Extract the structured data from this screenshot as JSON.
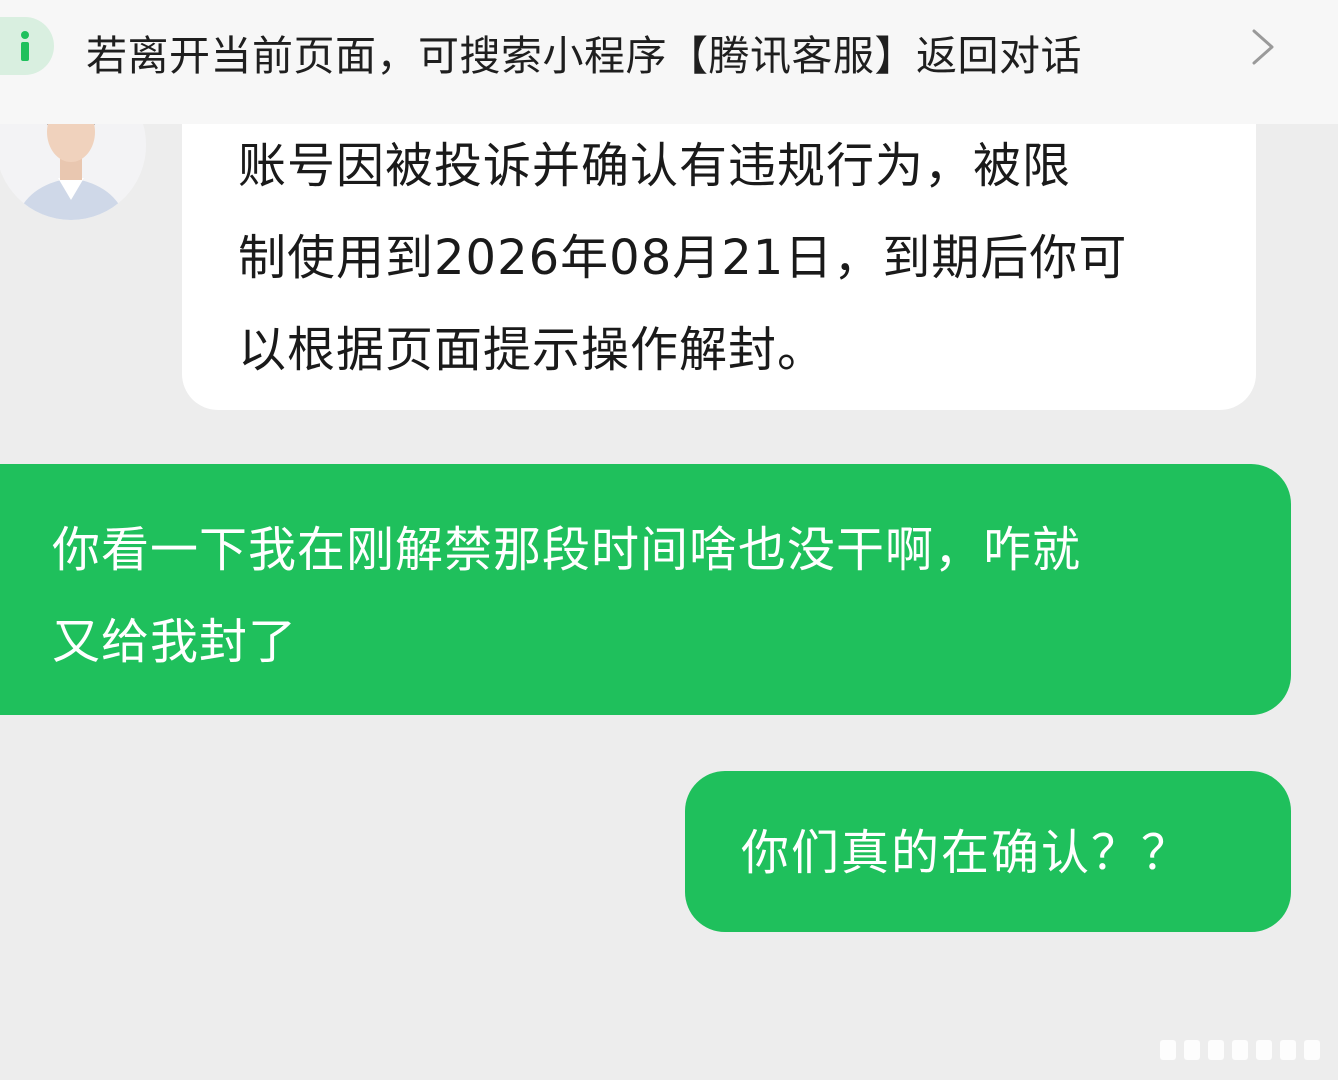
{
  "notice": {
    "text": "若离开当前页面，可搜索小程序【腾讯客服】返回对话",
    "icon": "info-icon",
    "accent_color": "#1fc05c"
  },
  "messages": [
    {
      "sender": "agent",
      "lines": [
        "账号因被投诉并确认有违规行为，被限",
        "制使用到2026年08月21日，到期后你可",
        "以根据页面提示操作解封。"
      ]
    },
    {
      "sender": "user",
      "lines": [
        "你看一下我在刚解禁那段时间啥也没干啊，咋就",
        "又给我封了"
      ]
    },
    {
      "sender": "user",
      "lines": [
        "你们真的在确认？？"
      ]
    }
  ],
  "colors": {
    "background": "#ededed",
    "incoming_bubble": "#ffffff",
    "outgoing_bubble": "#1fc05c"
  }
}
